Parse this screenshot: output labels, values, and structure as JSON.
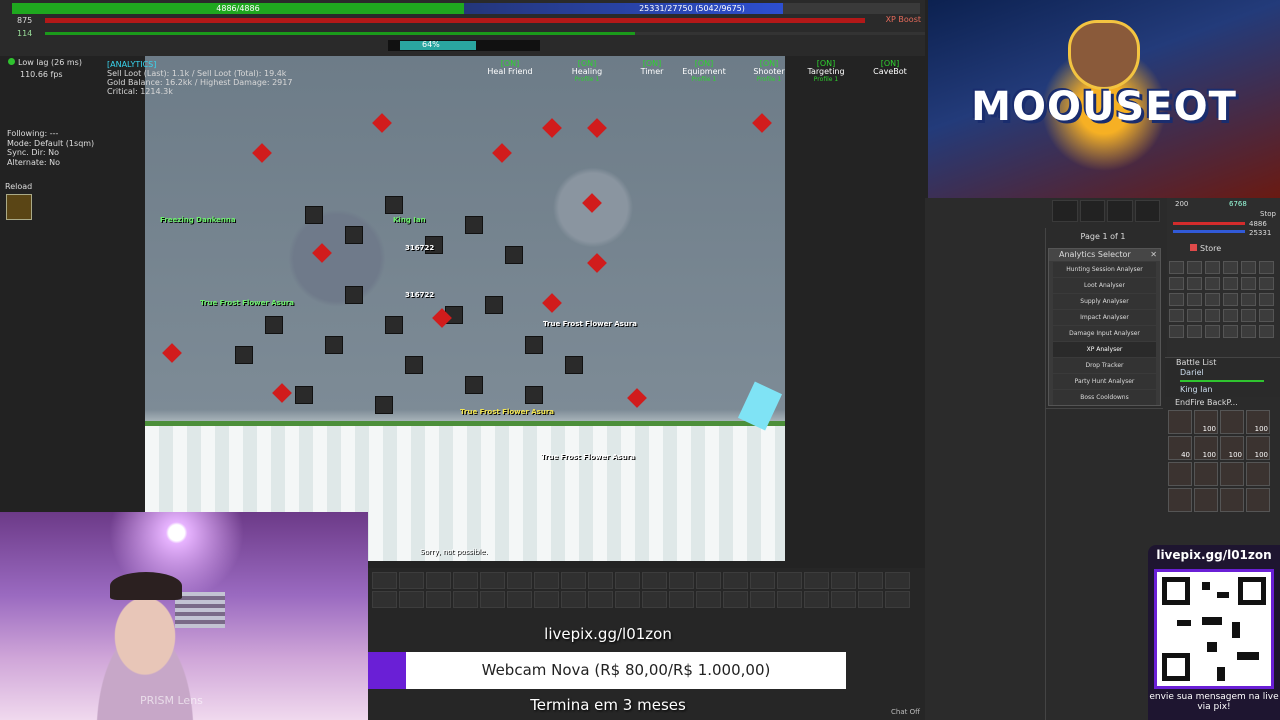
{
  "status": {
    "hp_text": "4886/4886",
    "mana_text": "25331/27750 (5042/9675)",
    "level": "875",
    "xp_boost": "XP Boost",
    "stamina": "114",
    "mini_pct": "64%"
  },
  "left": {
    "lag": "Low lag (26 ms)",
    "fps": "110.66 fps",
    "following": "Following: ---",
    "mode": "Mode: Default (1sqm)",
    "sync": "Sync. Dir: No",
    "alternate": "Alternate: No",
    "reload": "Reload"
  },
  "analytics": {
    "header": "[ANALYTICS]",
    "sell_loot": "Sell Loot (Last): 1.1k / Sell Loot (Total): 19.4k",
    "gold": "Gold Balance: 16.2kk / Highest Damage: 2917",
    "critical": "Critical: 1214.3k"
  },
  "modules": [
    {
      "state": "[ON]",
      "name": "Heal Friend",
      "profile": ""
    },
    {
      "state": "[ON]",
      "name": "Healing",
      "profile": "Profile 1"
    },
    {
      "state": "[ON]",
      "name": "Timer",
      "profile": ""
    },
    {
      "state": "[ON]",
      "name": "Equipment",
      "profile": "Profile 1"
    },
    {
      "state": "[ON]",
      "name": "Shooter",
      "profile": "Profile 1"
    },
    {
      "state": "[ON]",
      "name": "Targeting",
      "profile": "Profile 1"
    },
    {
      "state": "[ON]",
      "name": "CaveBot",
      "profile": ""
    }
  ],
  "game": {
    "labels": [
      {
        "text": "True Frost Flower Asura",
        "cls": "green"
      },
      {
        "text": "True Frost Flower Asura",
        "cls": "yellow"
      },
      {
        "text": "True Frost Flower Asura",
        "cls": "white"
      },
      {
        "text": "True Frost Flower Asura",
        "cls": "white"
      },
      {
        "text": "King Ian",
        "cls": "green"
      },
      {
        "text": "316722",
        "cls": "white"
      },
      {
        "text": "316722",
        "cls": "white"
      },
      {
        "text": "Freezing Dankenna",
        "cls": "green"
      }
    ],
    "sorry": "Sorry, not possible."
  },
  "logo": {
    "text": "MOOUSEOT"
  },
  "right": {
    "page_of": "Page 1 of 1",
    "analytics_selector": "Analytics Selector",
    "analysers": [
      "Hunting Session Analyser",
      "Loot Analyser",
      "Supply Analyser",
      "Impact Analyser",
      "Damage Input Analyser",
      "XP Analyser",
      "Drop Tracker",
      "Party Hunt Analyser",
      "Boss Cooldowns"
    ],
    "char_hp": "4886",
    "char_mp": "25331",
    "char_level": "200",
    "char_cap": "6768",
    "stop": "Stop",
    "store": "Store",
    "battle_title": "Battle List",
    "battle_entries": [
      "Dariel",
      "King Ian"
    ],
    "backpack_title": "EndFire BackP...",
    "bp_counts": [
      "",
      "100",
      "",
      "100",
      "40",
      "100",
      "100",
      "100",
      "",
      "",
      "",
      "",
      "",
      "",
      "",
      ""
    ]
  },
  "stream": {
    "webcam_overlay": "PRISM Lens",
    "livepix_url": "livepix.gg/l01zon",
    "goal_text": "Webcam Nova (R$ 80,00/R$ 1.000,00)",
    "termina": "Termina em 3 meses",
    "chat_off": "Chat Off",
    "qr_url": "livepix.gg/l01zon",
    "qr_caption": "envie sua mensagem na live via pix!"
  }
}
